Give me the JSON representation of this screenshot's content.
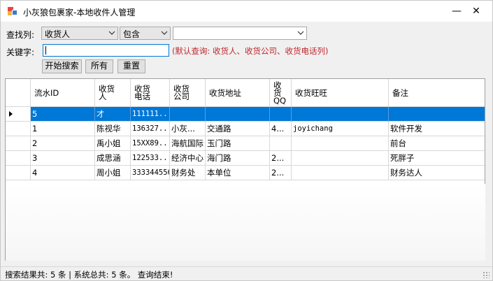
{
  "window": {
    "title": "小灰狼包裹家-本地收件人管理",
    "minimize_glyph": "—",
    "close_glyph": "✕"
  },
  "search": {
    "column_label": "查找列:",
    "column_value": "收货人",
    "operator_value": "包含",
    "third_value": "",
    "keyword_label": "关键字:",
    "keyword_value": "",
    "hint": "(默认查询: 收货人、收货公司、收货电话列)",
    "btn_search": "开始搜索",
    "btn_all": "所有",
    "btn_reset": "重置"
  },
  "grid": {
    "columns": [
      [
        "流水ID"
      ],
      [
        "收货",
        "人"
      ],
      [
        "收货",
        "电话"
      ],
      [
        "收货",
        "公司"
      ],
      [
        "收货地址"
      ],
      [
        "收",
        "货",
        "QQ"
      ],
      [
        "收货旺旺"
      ],
      [
        "备注"
      ]
    ],
    "rows": [
      [
        "5",
        "才",
        "111111...",
        "",
        "",
        "",
        "",
        ""
      ],
      [
        "1",
        "陈视华",
        "136327...",
        "小灰...",
        "交通路",
        "4...",
        "joyichang",
        "软件开发"
      ],
      [
        "2",
        "禹小姐",
        "15XX89...",
        "海航国际",
        "玉门路",
        "",
        "",
        "前台"
      ],
      [
        "3",
        "成思涵",
        "122533...",
        "经济中心",
        "海门路",
        "2...",
        "",
        "死胖子"
      ],
      [
        "4",
        "周小姐",
        "333344556",
        "财务处",
        "本单位",
        "2...",
        "",
        "财务达人"
      ]
    ],
    "selected_row": 0
  },
  "status": {
    "text": "搜索结果共: 5 条 | 系统总共: 5 条。 查询结束!"
  },
  "colors": {
    "selection": "#0078d7",
    "hint": "#c0282d"
  }
}
